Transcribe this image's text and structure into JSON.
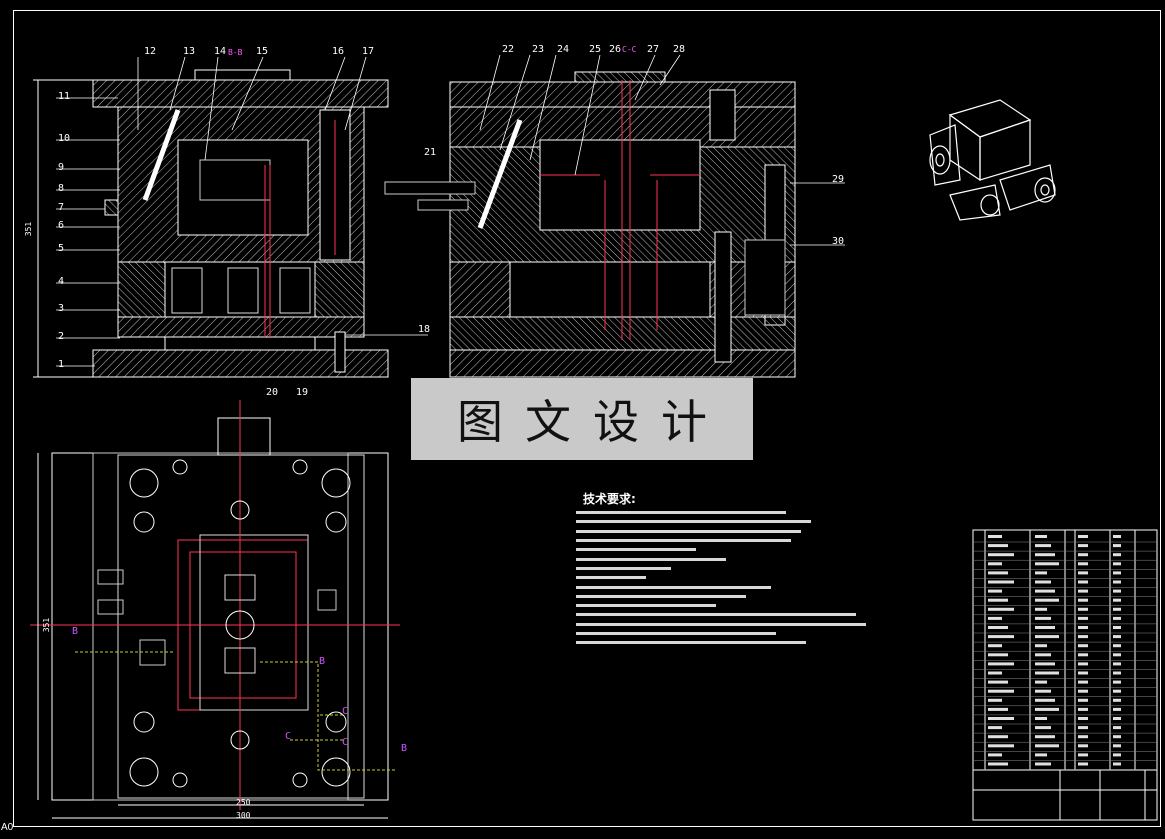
{
  "watermark": {
    "text": "图文设计"
  },
  "left_view_labels": [
    "11",
    "10",
    "9",
    "8",
    "7",
    "6",
    "5",
    "4",
    "3",
    "2",
    "1"
  ],
  "top_labels_left": [
    "12",
    "13",
    "14",
    "15",
    "16",
    "17"
  ],
  "section_mark_bb": "B-B",
  "top_labels_right": [
    "22",
    "23",
    "24",
    "25",
    "26",
    "27",
    "28"
  ],
  "section_mark_cc": "C-C",
  "callouts": {
    "n21": "21",
    "n18": "18",
    "n20": "20",
    "n19": "19",
    "n29": "29",
    "n30": "30"
  },
  "dimensions": {
    "height_side": "351",
    "height_plan": "351",
    "width_inner": "250",
    "width_outer": "300"
  },
  "section_letters": {
    "b1": "B",
    "b2": "B",
    "b3": "B",
    "c1": "C",
    "c2": "C",
    "c3": "C"
  },
  "tech_requirements": {
    "title": "技术要求:"
  },
  "title_block": {
    "sheet_size": "A0"
  }
}
